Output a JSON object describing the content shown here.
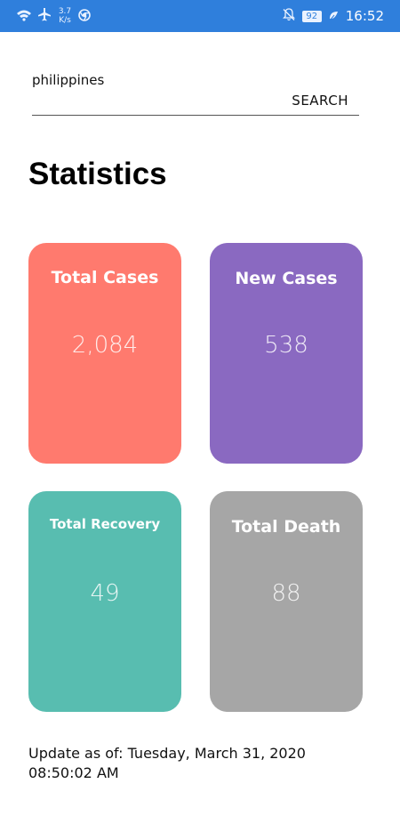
{
  "status_bar": {
    "net_speed_value": "3.7",
    "net_speed_unit": "K/s",
    "battery": "92",
    "time": "16:52",
    "icons": [
      "wifi-icon",
      "airplane-icon",
      "chrome-icon",
      "mute-icon",
      "leaf-icon"
    ]
  },
  "search": {
    "value": "philippines",
    "button_label": "SEARCH"
  },
  "page_title": "Statistics",
  "cards": {
    "total_cases": {
      "label": "Total Cases",
      "value": "2,084",
      "color": "#ff7a6e"
    },
    "new_cases": {
      "label": "New Cases",
      "value": "538",
      "color": "#8a69c1"
    },
    "total_recovery": {
      "label": "Total Recovery",
      "value": "49",
      "color": "#58bdb0"
    },
    "total_death": {
      "label": "Total Death",
      "value": "88",
      "color": "#a6a6a6"
    }
  },
  "update": {
    "label": "Update as of: Tuesday, March 31, 2020",
    "time": "08:50:02 AM"
  }
}
